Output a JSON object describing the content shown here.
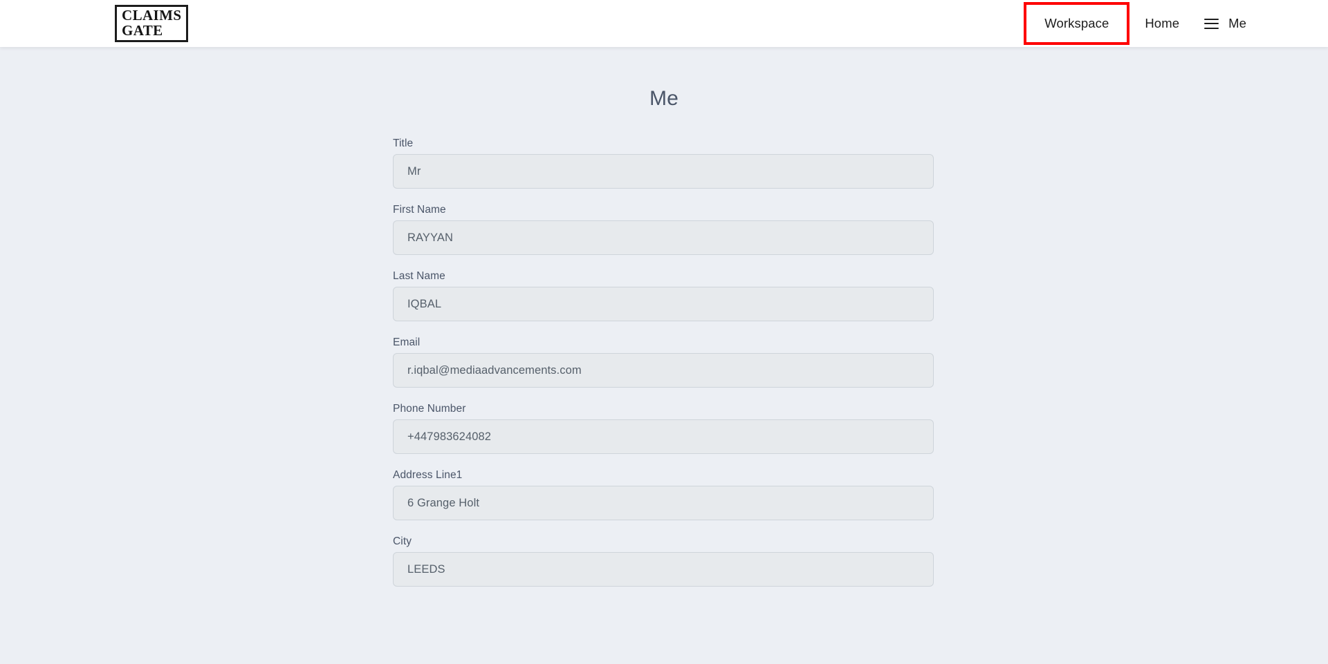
{
  "brand": {
    "line1": "CLAIMS",
    "line2": "GATE"
  },
  "nav": {
    "workspace_label": "Workspace",
    "home_label": "Home",
    "menu_icon": "hamburger-icon",
    "me_label": "Me",
    "highlight_color": "#fe0000",
    "highlighted_item": "Workspace"
  },
  "main": {
    "title": "Me",
    "fields": [
      {
        "label": "Title",
        "value": "Mr"
      },
      {
        "label": "First Name",
        "value": "RAYYAN"
      },
      {
        "label": "Last Name",
        "value": "IQBAL"
      },
      {
        "label": "Email",
        "value": "r.iqbal@mediaadvancements.com"
      },
      {
        "label": "Phone Number",
        "value": "+447983624082"
      },
      {
        "label": "Address Line1",
        "value": "6 Grange Holt"
      },
      {
        "label": "City",
        "value": "LEEDS"
      }
    ]
  },
  "colors": {
    "page_background": "#eceff4",
    "header_background": "#ffffff",
    "input_background": "#e7eaed",
    "input_border": "#ced4da",
    "text": "#4a5568"
  }
}
